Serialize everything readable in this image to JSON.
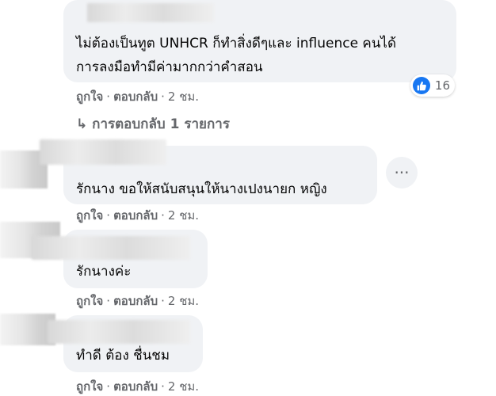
{
  "comments": [
    {
      "text_lines": [
        "ไม่ต้องเป็นทูต UNHCR ก็ทำสิ่งดีๆและ influence คนได้",
        "การลงมือทำมีค่ามากกว่าคำสอน"
      ],
      "like_label": "ถูกใจ",
      "reply_label": "ตอบกลับ",
      "time": "2 ชม.",
      "reaction_count": "16",
      "reply_toggle": "การตอบกลับ 1 รายการ"
    },
    {
      "text_lines": [
        "รักนาง ขอให้สนับสนุนให้นางเปงนายก หญิง"
      ],
      "like_label": "ถูกใจ",
      "reply_label": "ตอบกลับ",
      "time": "2 ชม.",
      "more_symbol": "···"
    },
    {
      "text_lines": [
        "รักนางค่ะ"
      ],
      "like_label": "ถูกใจ",
      "reply_label": "ตอบกลับ",
      "time": "2 ชม."
    },
    {
      "text_lines": [
        "ทำดี ต้อง ชื่นชม"
      ],
      "like_label": "ถูกใจ",
      "reply_label": "ตอบกลับ",
      "time": "2 ชม."
    }
  ],
  "colors": {
    "bubble": "#f0f2f5",
    "secondary_text": "#65676b",
    "like_blue": "#1877f2"
  }
}
